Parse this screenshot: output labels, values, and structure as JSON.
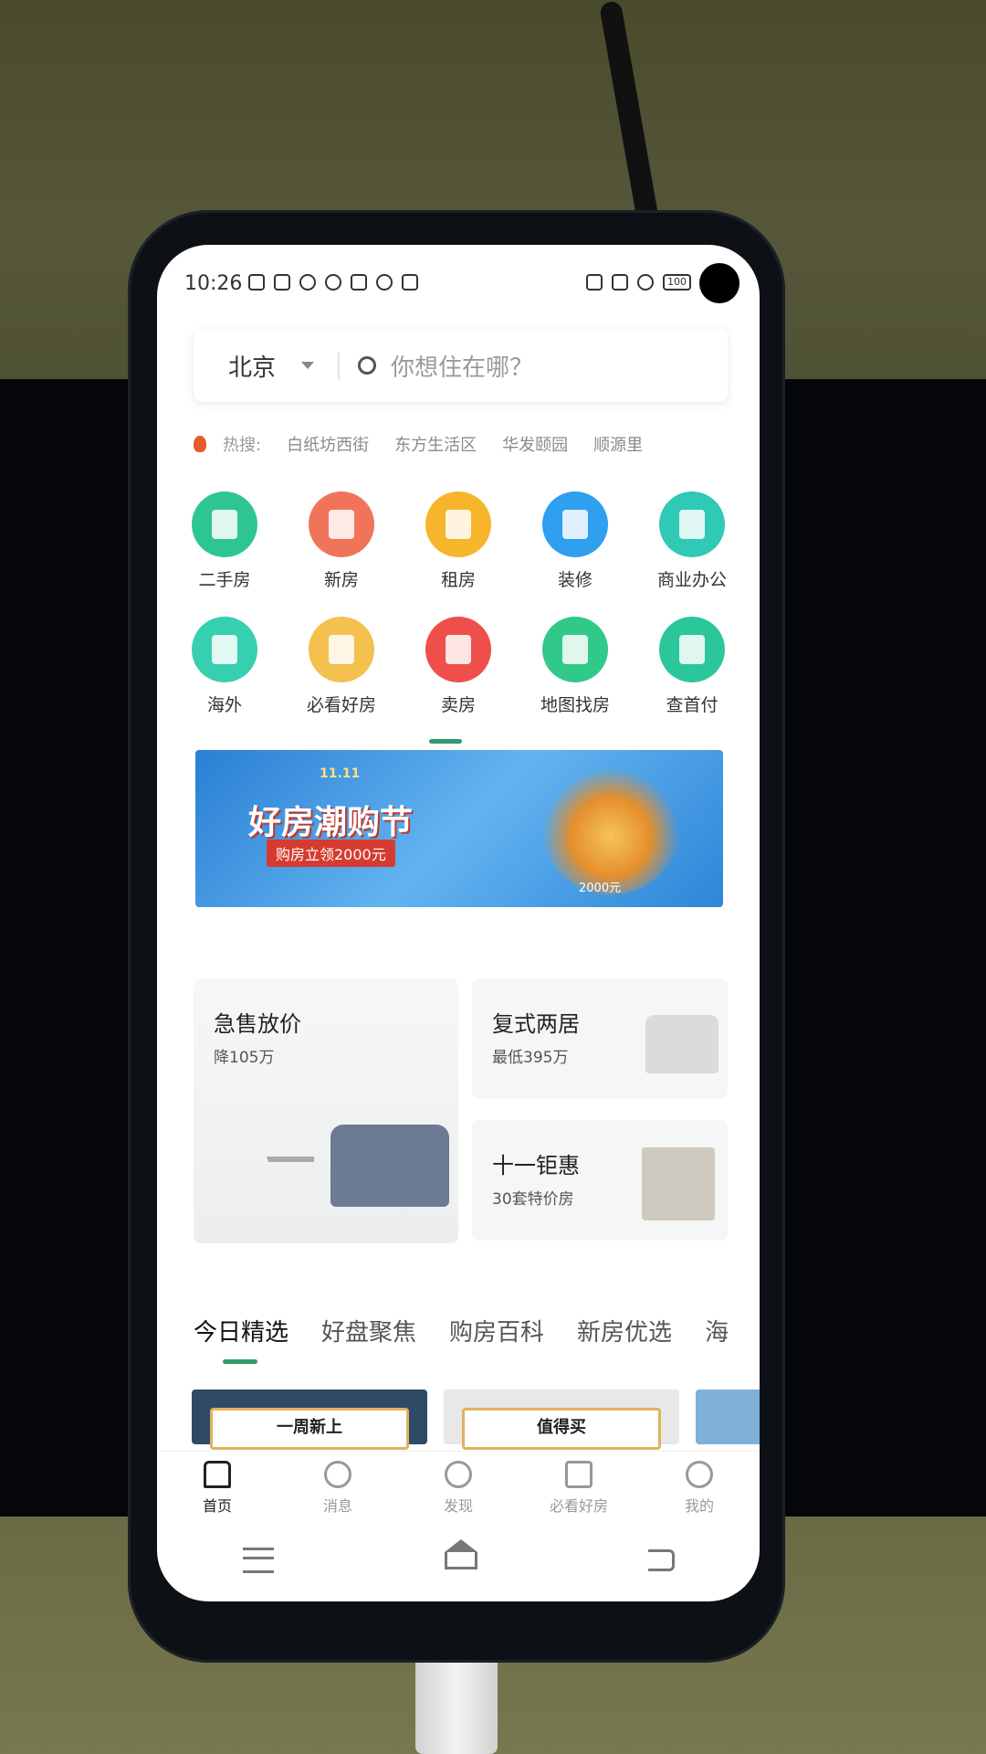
{
  "status_bar": {
    "time": "10:26",
    "battery": "100"
  },
  "search": {
    "city": "北京",
    "placeholder": "你想住在哪？"
  },
  "hot_search": {
    "label": "热搜:",
    "items": [
      "白纸坊西街",
      "东方生活区",
      "华发颐园",
      "顺源里"
    ]
  },
  "categories": [
    {
      "label": "二手房",
      "icon": "resale-house-icon",
      "color": "#2dc690"
    },
    {
      "label": "新房",
      "icon": "new-house-icon",
      "color": "#f0745a"
    },
    {
      "label": "租房",
      "icon": "rent-door-icon",
      "color": "#f7b52b"
    },
    {
      "label": "装修",
      "icon": "paint-brush-icon",
      "color": "#2f9ff0"
    },
    {
      "label": "商业办公",
      "icon": "office-building-icon",
      "color": "#2fc9b6"
    },
    {
      "label": "海外",
      "icon": "globe-icon",
      "color": "#36cfb0"
    },
    {
      "label": "必看好房",
      "icon": "heart-house-icon",
      "color": "#f4c04e"
    },
    {
      "label": "卖房",
      "icon": "sale-tag-icon",
      "color": "#ef4f4b"
    },
    {
      "label": "地图找房",
      "icon": "map-pin-icon",
      "color": "#31c98a"
    },
    {
      "label": "查首付",
      "icon": "wallet-search-icon",
      "color": "#2bc79b"
    }
  ],
  "banner": {
    "tag": "11.11",
    "title": "好房潮购节",
    "subtitle": "购房立领2000元",
    "coin_text": "2000元"
  },
  "promos": {
    "big": {
      "title": "急售放价",
      "subtitle": "降105万"
    },
    "top_right": {
      "title": "复式两居",
      "subtitle": "最低395万"
    },
    "bottom_right": {
      "title": "十一钜惠",
      "subtitle": "30套特价房"
    }
  },
  "tabs": [
    "今日精选",
    "好盘聚焦",
    "购房百科",
    "新房优选",
    "海"
  ],
  "feature_cards": [
    "一周新上",
    "值得买"
  ],
  "bottom_nav": [
    {
      "label": "首页",
      "icon": "home-icon"
    },
    {
      "label": "消息",
      "icon": "chat-icon"
    },
    {
      "label": "发现",
      "icon": "compass-icon"
    },
    {
      "label": "必看好房",
      "icon": "building-icon"
    },
    {
      "label": "我的",
      "icon": "profile-icon"
    }
  ],
  "colors": {
    "accent": "#2e9b6a",
    "text": "#333333",
    "muted": "#999999"
  }
}
